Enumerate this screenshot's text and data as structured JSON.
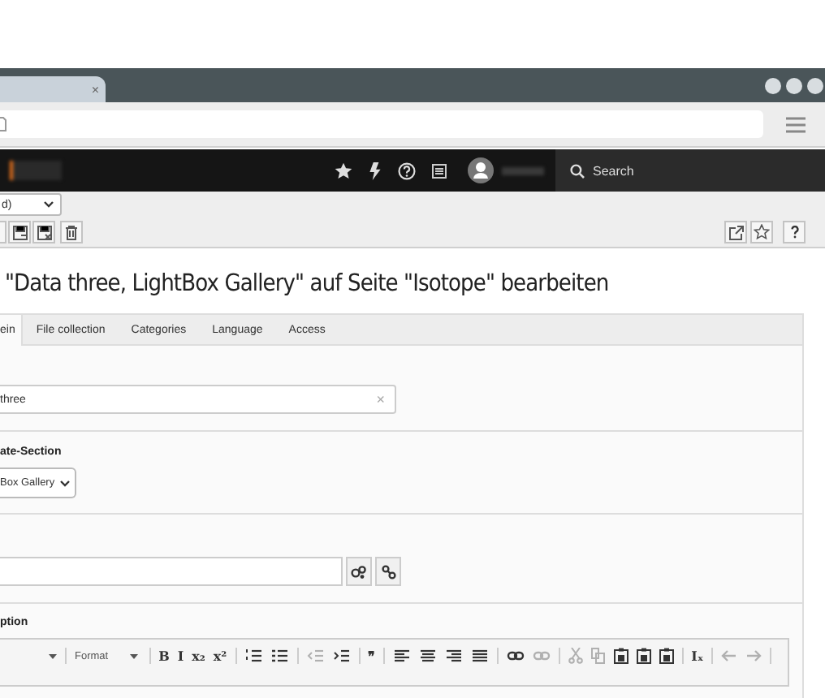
{
  "browser": {
    "tab_close": "×"
  },
  "topbar": {
    "search_placeholder": "Search"
  },
  "docheader": {
    "language_select": "d)"
  },
  "title": "\"Data three, LightBox Gallery\" auf Seite \"Isotope\" bearbeiten",
  "tabs": [
    {
      "label": "ein",
      "selected": true
    },
    {
      "label": "File collection",
      "selected": false
    },
    {
      "label": "Categories",
      "selected": false
    },
    {
      "label": "Language",
      "selected": false
    },
    {
      "label": "Access",
      "selected": false
    }
  ],
  "fields": [
    {
      "kind": "text",
      "value": "three",
      "clear": "×"
    },
    {
      "kind": "select",
      "label": "ate-Section",
      "value": "Box Gallery"
    },
    {
      "kind": "link"
    },
    {
      "kind": "rte",
      "label": "ption",
      "format": "Format",
      "toolbar": [
        [
          {
            "kind": "text",
            "label": "B",
            "disabled": false
          },
          {
            "kind": "text",
            "label": "I",
            "disabled": false
          },
          {
            "kind": "text",
            "label": "x₂",
            "disabled": false
          },
          {
            "kind": "text",
            "label": "x²",
            "disabled": false
          }
        ],
        [
          {
            "kind": "olist",
            "disabled": false
          },
          {
            "kind": "ulist",
            "disabled": false
          }
        ],
        [
          {
            "kind": "outdent",
            "disabled": true
          },
          {
            "kind": "indent",
            "disabled": false
          }
        ],
        [
          {
            "kind": "text",
            "label": "❞",
            "disabled": false
          }
        ],
        [
          {
            "kind": "align-left",
            "disabled": false
          },
          {
            "kind": "align-center",
            "disabled": false
          },
          {
            "kind": "align-right",
            "disabled": false
          },
          {
            "kind": "justify",
            "disabled": false
          }
        ],
        [
          {
            "kind": "link",
            "disabled": false
          },
          {
            "kind": "unlink",
            "disabled": true
          }
        ],
        [
          {
            "kind": "cut",
            "disabled": true
          },
          {
            "kind": "copy",
            "disabled": true
          },
          {
            "kind": "paste",
            "disabled": false
          },
          {
            "kind": "paste",
            "disabled": false
          },
          {
            "kind": "paste",
            "disabled": false
          }
        ],
        [
          {
            "kind": "text",
            "label": "Iₓ",
            "disabled": false
          }
        ],
        [
          {
            "kind": "undo",
            "disabled": true
          },
          {
            "kind": "redo",
            "disabled": true
          }
        ]
      ]
    }
  ]
}
